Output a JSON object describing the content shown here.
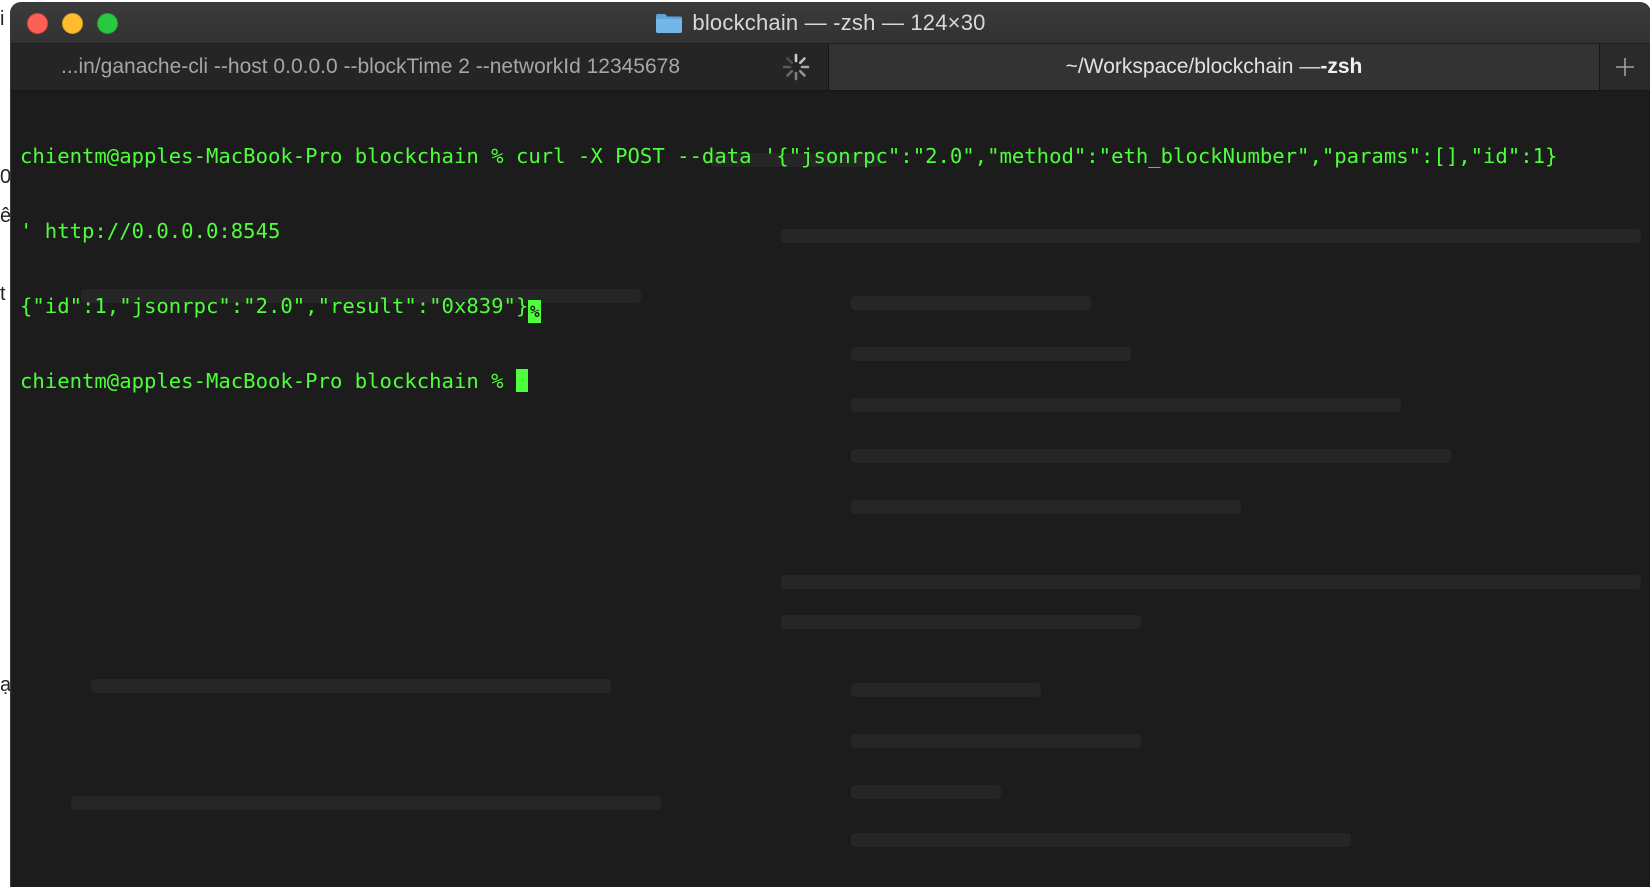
{
  "window": {
    "title": "blockchain — -zsh — 124×30"
  },
  "tabs": [
    {
      "label": "...in/ganache-cli --host 0.0.0.0 --blockTime 2 --networkId 12345678",
      "active": false
    },
    {
      "label_prefix": "~/Workspace/blockchain — ",
      "label_bold": "-zsh",
      "active": true
    }
  ],
  "terminal": {
    "lines": [
      "chientm@apples-MacBook-Pro blockchain % curl -X POST --data '{\"jsonrpc\":\"2.0\",\"method\":\"eth_blockNumber\",\"params\":[],\"id\":1}",
      "' http://0.0.0.0:8545",
      "{\"id\":1,\"jsonrpc\":\"2.0\",\"result\":\"0x839\"}",
      "chientm@apples-MacBook-Pro blockchain % "
    ],
    "no_newline_mark": "%"
  },
  "background_fragments": [
    "i",
    "0",
    "ê",
    "t",
    "ạ"
  ],
  "colors": {
    "terminal_text": "#4dff3a",
    "terminal_bg": "#1c1c1c",
    "close": "#fe5f57",
    "minimize": "#febc2e",
    "maximize": "#28c840",
    "folder": "#62a9e0"
  },
  "icons": {
    "folder": "folder-icon",
    "spinner": "activity-spinner-icon",
    "new_tab": "plus-icon"
  }
}
